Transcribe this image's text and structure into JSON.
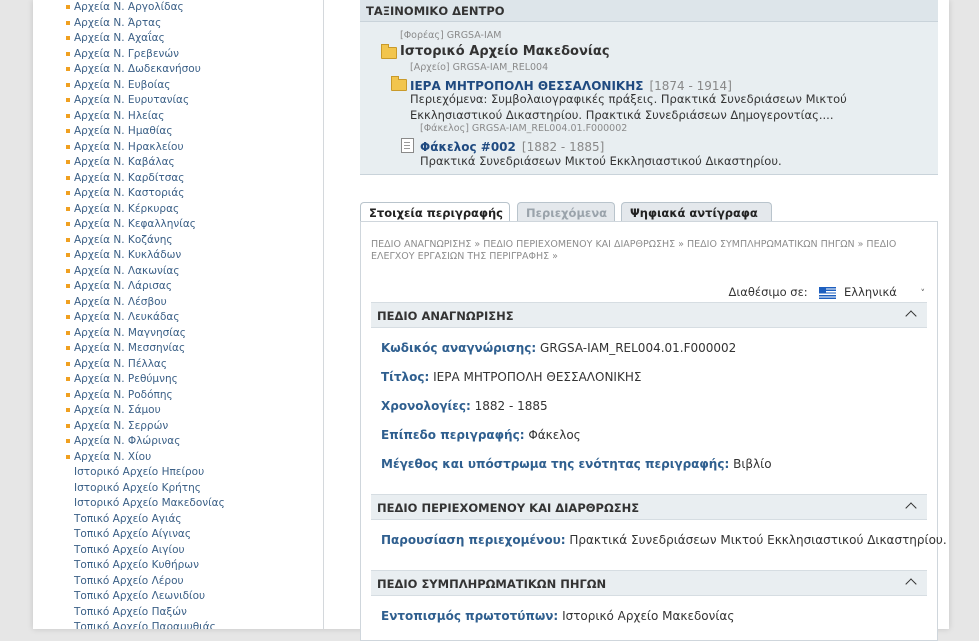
{
  "sidebar": {
    "items": [
      {
        "label": "Αρχεία Ν. Αργολίδας",
        "icon": "square-bullet-icon"
      },
      {
        "label": "Αρχεία Ν. Άρτας",
        "icon": "square-bullet-icon"
      },
      {
        "label": "Αρχεία Ν. Αχαΐας",
        "icon": "square-bullet-icon"
      },
      {
        "label": "Αρχεία Ν. Γρεβενών",
        "icon": "square-bullet-icon"
      },
      {
        "label": "Αρχεία Ν. Δωδεκανήσου",
        "icon": "square-bullet-icon"
      },
      {
        "label": "Αρχεία Ν. Ευβοίας",
        "icon": "square-bullet-icon"
      },
      {
        "label": "Αρχεία Ν. Ευρυτανίας",
        "icon": "square-bullet-icon"
      },
      {
        "label": "Αρχεία Ν. Ηλείας",
        "icon": "square-bullet-icon"
      },
      {
        "label": "Αρχεία Ν. Ημαθίας",
        "icon": "square-bullet-icon"
      },
      {
        "label": "Αρχεία Ν. Ηρακλείου",
        "icon": "square-bullet-icon"
      },
      {
        "label": "Αρχεία Ν. Καβάλας",
        "icon": "square-bullet-icon"
      },
      {
        "label": "Αρχεία Ν. Καρδίτσας",
        "icon": "square-bullet-icon"
      },
      {
        "label": "Αρχεία Ν. Καστοριάς",
        "icon": "square-bullet-icon"
      },
      {
        "label": "Αρχεία Ν. Κέρκυρας",
        "icon": "square-bullet-icon"
      },
      {
        "label": "Αρχεία Ν. Κεφαλληνίας",
        "icon": "square-bullet-icon"
      },
      {
        "label": "Αρχεία Ν. Κοζάνης",
        "icon": "square-bullet-icon"
      },
      {
        "label": "Αρχεία Ν. Κυκλάδων",
        "icon": "square-bullet-icon"
      },
      {
        "label": "Αρχεία Ν. Λακωνίας",
        "icon": "square-bullet-icon"
      },
      {
        "label": "Αρχεία Ν. Λάρισας",
        "icon": "square-bullet-icon"
      },
      {
        "label": "Αρχεία Ν. Λέσβου",
        "icon": "square-bullet-icon"
      },
      {
        "label": "Αρχεία Ν. Λευκάδας",
        "icon": "square-bullet-icon"
      },
      {
        "label": "Αρχεία Ν. Μαγνησίας",
        "icon": "square-bullet-icon"
      },
      {
        "label": "Αρχεία Ν. Μεσσηνίας",
        "icon": "square-bullet-icon"
      },
      {
        "label": "Αρχεία Ν. Πέλλας",
        "icon": "square-bullet-icon"
      },
      {
        "label": "Αρχεία Ν. Ρεθύμνης",
        "icon": "square-bullet-icon"
      },
      {
        "label": "Αρχεία Ν. Ροδόπης",
        "icon": "square-bullet-icon"
      },
      {
        "label": "Αρχεία Ν. Σάμου",
        "icon": "square-bullet-icon"
      },
      {
        "label": "Αρχεία Ν. Σερρών",
        "icon": "square-bullet-icon"
      },
      {
        "label": "Αρχεία Ν. Φλώρινας",
        "icon": "square-bullet-icon"
      },
      {
        "label": "Αρχεία Ν. Χίου",
        "icon": "square-bullet-icon"
      },
      {
        "label": "Ιστορικό Αρχείο Ηπείρου",
        "icon": "none"
      },
      {
        "label": "Ιστορικό Αρχείο Κρήτης",
        "icon": "none"
      },
      {
        "label": "Ιστορικό Αρχείο Μακεδονίας",
        "icon": "none"
      },
      {
        "label": "Τοπικό Αρχείο Αγιάς",
        "icon": "none"
      },
      {
        "label": "Τοπικό Αρχείο Αίγινας",
        "icon": "none"
      },
      {
        "label": "Τοπικό Αρχείο Αιγίου",
        "icon": "none"
      },
      {
        "label": "Τοπικό Αρχείο Κυθήρων",
        "icon": "none"
      },
      {
        "label": "Τοπικό Αρχείο Λέρου",
        "icon": "none"
      },
      {
        "label": "Τοπικό Αρχείο Λεωνιδίου",
        "icon": "none"
      },
      {
        "label": "Τοπικό Αρχείο Παξών",
        "icon": "none"
      },
      {
        "label": "Τοπικό Αρχείο Παραμυθιάς",
        "icon": "none"
      }
    ]
  },
  "tree": {
    "header": "ΤΑΞΙΝΟΜΙΚΟ ΔΕΝΤΡΟ",
    "level1_meta": "[Φορέας] GRGSA-IAM",
    "level1_title": "Ιστορικό Αρχείο Μακεδονίας",
    "level2_meta": "[Αρχείο] GRGSA-IAM_REL004",
    "level2_title": "ΙΕΡΑ ΜΗΤΡΟΠΟΛΗ ΘΕΣΣΑΛΟΝΙΚΗΣ",
    "level2_dates": "[1874 - 1914]",
    "level2_desc": "Περιεχόμενα: Συμβολαιογραφικές πράξεις. Πρακτικά Συνεδριάσεων Μικτού Εκκλησιαστικού Δικαστηρίου. Πρακτικά Συνεδριάσεων Δημογεροντίας....",
    "level3_meta": "[Φάκελος] GRGSA-IAM_REL004.01.F000002",
    "level3_title": "Φάκελος #002",
    "level3_dates": "[1882 - 1885]",
    "level3_desc": "Πρακτικά Συνεδριάσεων Μικτού Εκκλησιαστικού Δικαστηρίου."
  },
  "tabs": [
    {
      "label": "Στοιχεία περιγραφής",
      "state": "active"
    },
    {
      "label": "Περιεχόμενα",
      "state": "disabled"
    },
    {
      "label": "Ψηφιακά αντίγραφα",
      "state": "normal"
    }
  ],
  "breadcrumbs": "ΠΕΔΙΟ ΑΝΑΓΝΩΡΙΣΗΣ » ΠΕΔΙΟ ΠΕΡΙΕΧΟΜΕΝΟΥ ΚΑΙ ΔΙΑΡΘΡΩΣΗΣ » ΠΕΔΙΟ ΣΥΜΠΛΗΡΩΜΑΤΙΚΩΝ ΠΗΓΩΝ » ΠΕΔΙΟ ΕΛΕΓΧΟΥ ΕΡΓΑΣΙΩΝ ΤΗΣ ΠΕΡΙΓΡΑΦΗΣ »",
  "language": {
    "label": "Διαθέσιμο σε:",
    "value": "Ελληνικά",
    "flag_icon": "greek-flag-icon"
  },
  "sections": {
    "identification": {
      "title": "ΠΕΔΙΟ ΑΝΑΓΝΩΡΙΣΗΣ",
      "fields": [
        {
          "label": "Κωδικός αναγνώρισης:",
          "value": "GRGSA-IAM_REL004.01.F000002"
        },
        {
          "label": "Τίτλος:",
          "value": "ΙΕΡΑ ΜΗΤΡΟΠΟΛΗ ΘΕΣΣΑΛΟΝΙΚΗΣ"
        },
        {
          "label": "Χρονολογίες:",
          "value": "1882 - 1885"
        },
        {
          "label": "Επίπεδο περιγραφής:",
          "value": "Φάκελος"
        },
        {
          "label": "Μέγεθος και υπόστρωμα της ενότητας περιγραφής:",
          "value": "Βιβλίο"
        }
      ]
    },
    "content": {
      "title": "ΠΕΔΙΟ ΠΕΡΙΕΧΟΜΕΝΟΥ ΚΑΙ ΔΙΑΡΘΡΩΣΗΣ",
      "fields": [
        {
          "label": "Παρουσίαση περιεχομένου:",
          "value": "Πρακτικά Συνεδριάσεων Μικτού Εκκλησιαστικού Δικαστηρίου."
        }
      ]
    },
    "allied": {
      "title": "ΠΕΔΙΟ ΣΥΜΠΛΗΡΩΜΑΤΙΚΩΝ ΠΗΓΩΝ",
      "fields": [
        {
          "label": "Εντοπισμός πρωτοτύπων:",
          "value": "Ιστορικό Αρχείο Μακεδονίας"
        }
      ]
    }
  },
  "colors": {
    "link": "#3a5f86",
    "label_blue": "#2f5f8f",
    "tree_title_blue": "#1f4a80",
    "bullet_orange": "#f0a020",
    "tree_bg": "#e8eef1"
  }
}
